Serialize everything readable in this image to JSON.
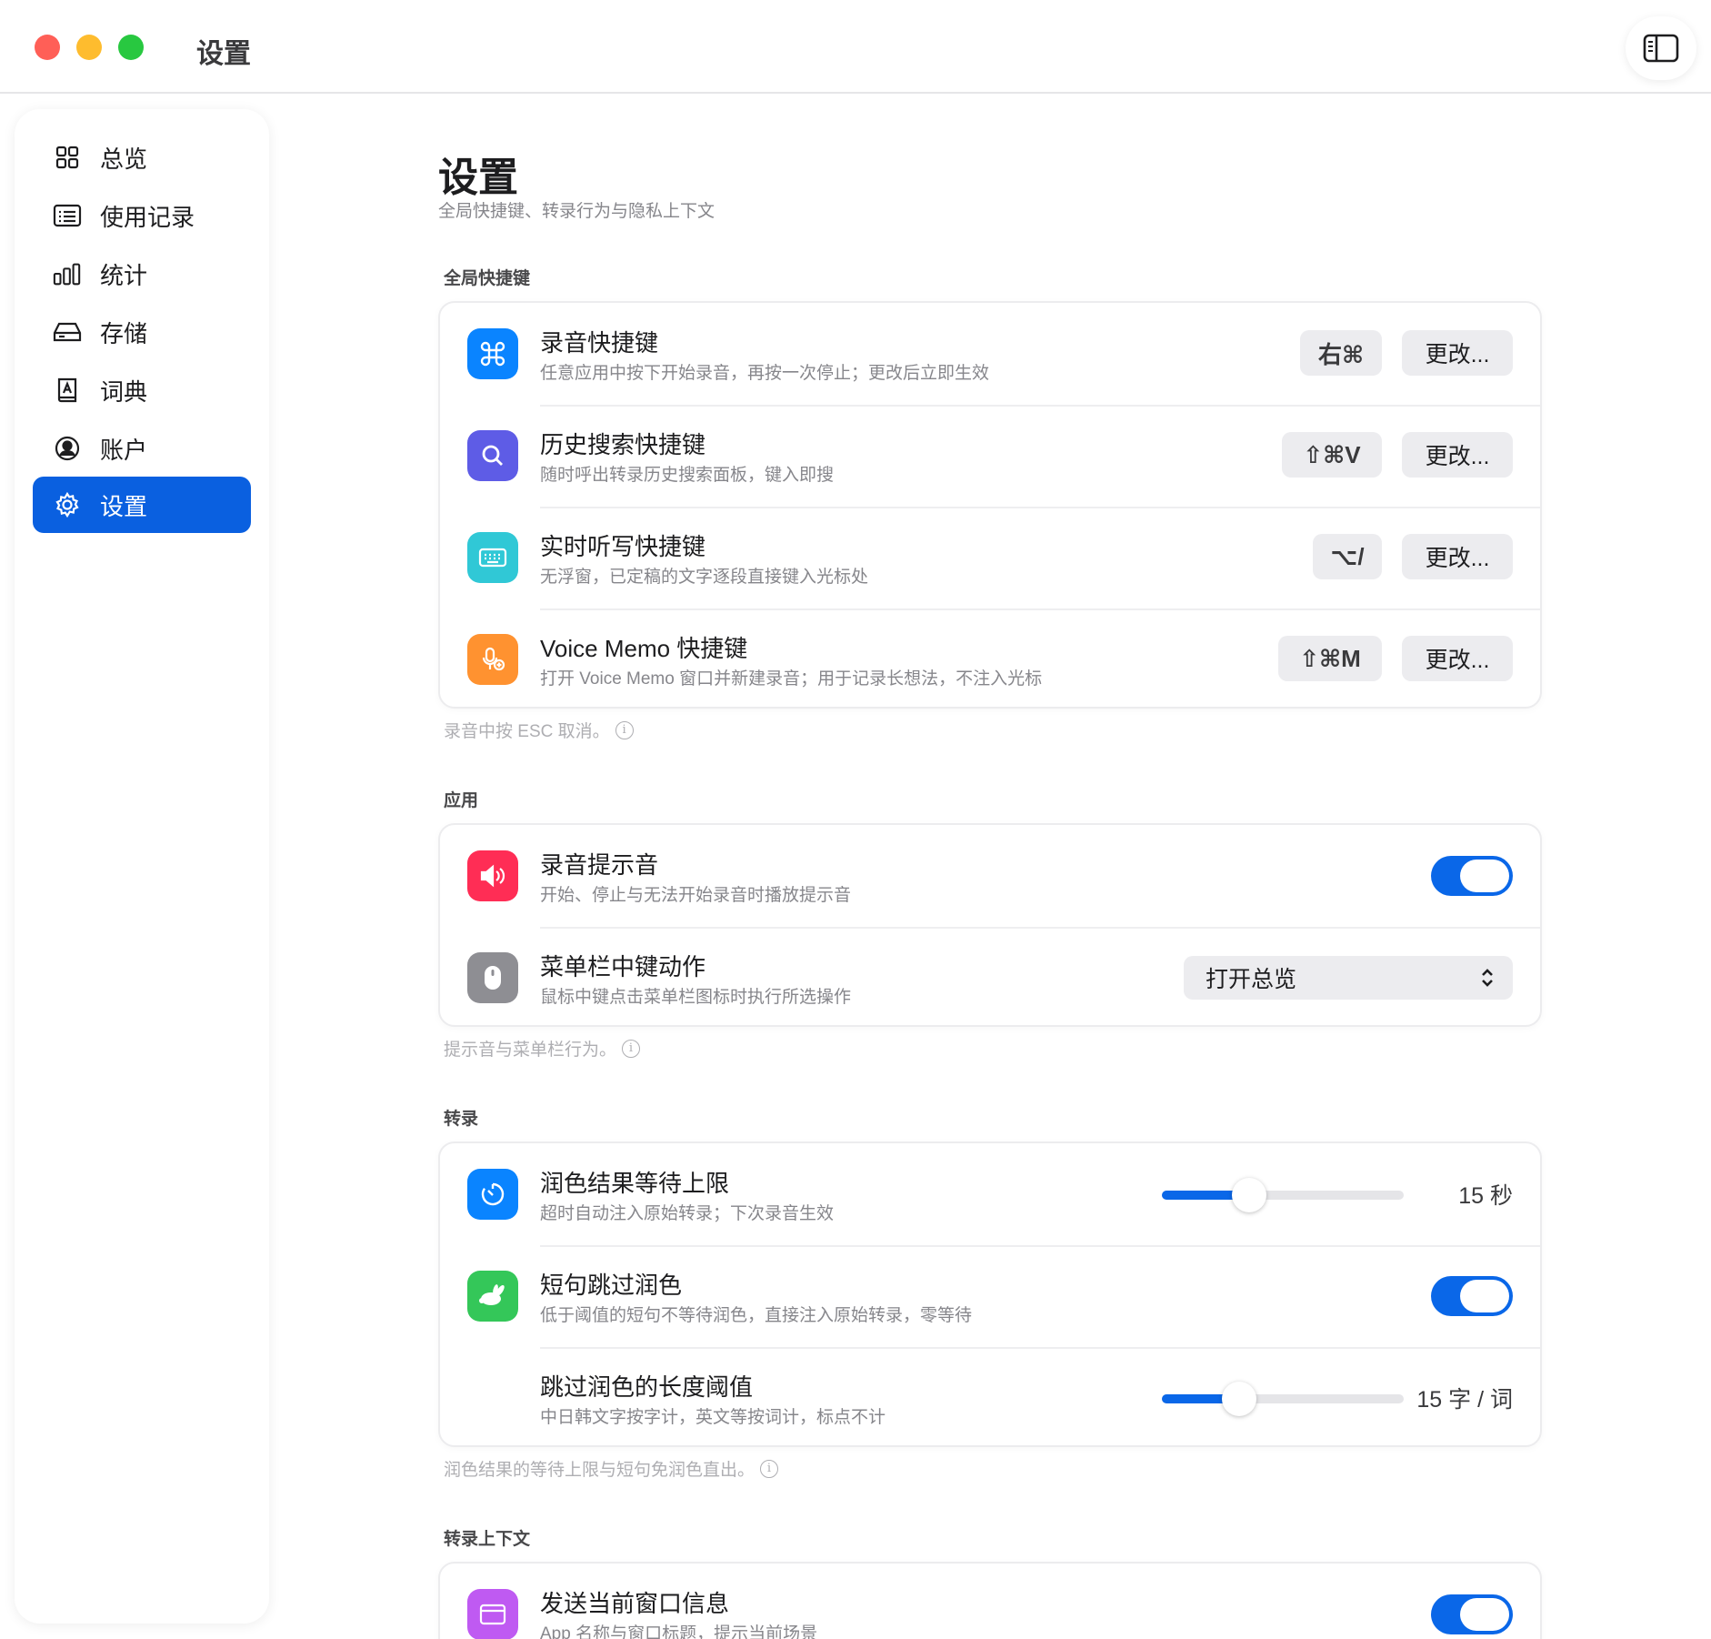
{
  "window": {
    "title": "设置"
  },
  "sidebar": {
    "items": [
      {
        "label": "总览",
        "icon": "grid-icon"
      },
      {
        "label": "使用记录",
        "icon": "list-icon"
      },
      {
        "label": "统计",
        "icon": "bar-chart-icon"
      },
      {
        "label": "存储",
        "icon": "drive-icon"
      },
      {
        "label": "词典",
        "icon": "dictionary-icon"
      },
      {
        "label": "账户",
        "icon": "person-circle-icon"
      },
      {
        "label": "设置",
        "icon": "gear-icon",
        "active": true
      }
    ]
  },
  "page": {
    "title": "设置",
    "subtitle": "全局快捷键、转录行为与隐私上下文"
  },
  "shortcuts": {
    "label": "全局快捷键",
    "change_label": "更改...",
    "rows": [
      {
        "title": "录音快捷键",
        "desc": "任意应用中按下开始录音，再按一次停止；更改后立即生效",
        "key": "右⌘",
        "icon": "command-icon",
        "color": "#0a84ff"
      },
      {
        "title": "历史搜索快捷键",
        "desc": "随时呼出转录历史搜索面板，键入即搜",
        "key": "⇧⌘V",
        "icon": "magnifier-icon",
        "color": "#5e5ce6"
      },
      {
        "title": "实时听写快捷键",
        "desc": "无浮窗，已定稿的文字逐段直接键入光标处",
        "key": "⌥/",
        "icon": "keyboard-icon",
        "color": "#30c8d6"
      },
      {
        "title": "Voice Memo 快捷键",
        "desc": "打开 Voice Memo 窗口并新建录音；用于记录长想法，不注入光标",
        "key": "⇧⌘M",
        "icon": "mic-plus-icon",
        "color": "#ff9230"
      }
    ],
    "footnote": "录音中按 ESC 取消。"
  },
  "app": {
    "label": "应用",
    "sound": {
      "title": "录音提示音",
      "desc": "开始、停止与无法开始录音时播放提示音",
      "on": true,
      "icon": "speaker-icon",
      "color": "#ff2d55"
    },
    "middle_click": {
      "title": "菜单栏中键动作",
      "desc": "鼠标中键点击菜单栏图标时执行所选操作",
      "value": "打开总览",
      "icon": "mouse-icon",
      "color": "#8e8e93"
    },
    "footnote": "提示音与菜单栏行为。"
  },
  "transcribe": {
    "label": "转录",
    "wait": {
      "title": "润色结果等待上限",
      "desc": "超时自动注入原始转录；下次录音生效",
      "value_text": "15 秒",
      "level": 0.36,
      "icon": "timer-icon",
      "color": "#0a84ff"
    },
    "skip": {
      "title": "短句跳过润色",
      "desc": "低于阈值的短句不等待润色，直接注入原始转录，零等待",
      "on": true,
      "icon": "rabbit-icon",
      "color": "#34c759"
    },
    "threshold": {
      "title": "跳过润色的长度阈值",
      "desc": "中日韩文字按字计，英文等按词计，标点不计",
      "value_text": "15 字 / 词",
      "level": 0.32
    },
    "footnote": "润色结果的等待上限与短句免润色直出。"
  },
  "context": {
    "label": "转录上下文",
    "window_info": {
      "title": "发送当前窗口信息",
      "desc": "App 名称与窗口标题，提示当前场景",
      "on": true,
      "icon": "window-icon",
      "color": "#bf5af2"
    }
  }
}
